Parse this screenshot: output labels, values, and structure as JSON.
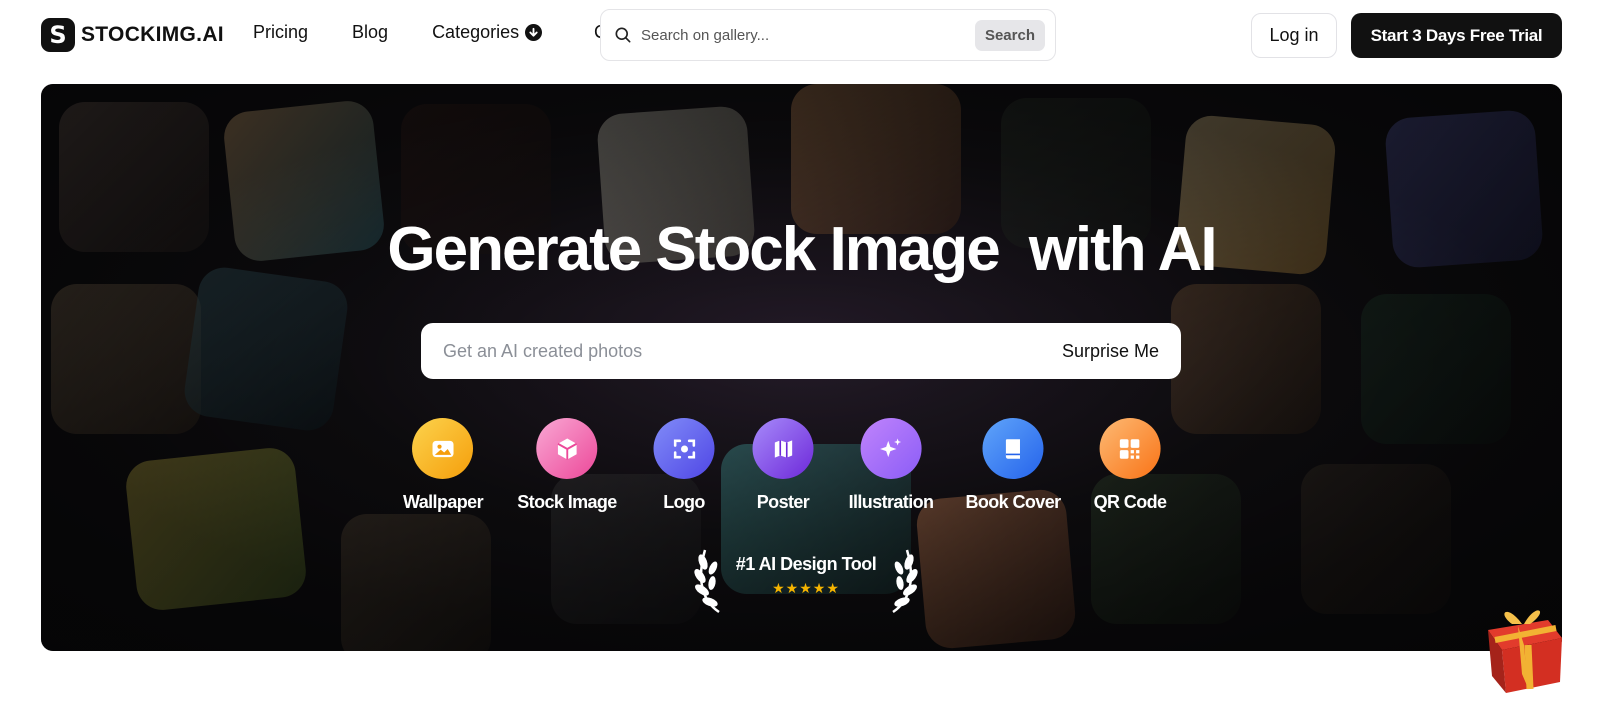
{
  "brand": {
    "name": "STOCKIMG.AI",
    "mark": "S"
  },
  "nav": {
    "items": [
      "Pricing",
      "Blog",
      "Categories"
    ],
    "hidden_item_fragment": "C"
  },
  "gallery_search": {
    "placeholder": "Search on gallery...",
    "button": "Search"
  },
  "auth": {
    "login": "Log in",
    "trial": "Start 3 Days Free Trial"
  },
  "hero": {
    "title_part1": "Generate Stock Image",
    "title_part2": "with AI",
    "prompt_placeholder": "Get an AI created photos",
    "surprise_label": "Surprise Me"
  },
  "categories": [
    {
      "label": "Wallpaper",
      "icon": "image-icon",
      "color_from": "#fcd34d",
      "color_to": "#f59e0b"
    },
    {
      "label": "Stock Image",
      "icon": "cube-icon",
      "color_from": "#f9a8d4",
      "color_to": "#ec4899"
    },
    {
      "label": "Logo",
      "icon": "focus-icon",
      "color_from": "#818cf8",
      "color_to": "#4f46e5"
    },
    {
      "label": "Poster",
      "icon": "map-icon",
      "color_from": "#a78bfa",
      "color_to": "#6d28d9"
    },
    {
      "label": "Illustration",
      "icon": "sparkles-icon",
      "color_from": "#c084fc",
      "color_to": "#8b5cf6"
    },
    {
      "label": "Book Cover",
      "icon": "book-icon",
      "color_from": "#60a5fa",
      "color_to": "#2563eb"
    },
    {
      "label": "QR Code",
      "icon": "qr-icon",
      "color_from": "#fdba74",
      "color_to": "#f97316"
    }
  ],
  "award": {
    "title": "#1 AI Design Tool",
    "stars": "★★★★★"
  },
  "colors": {
    "accent_dark": "#111111",
    "hero_bg": "#0b0b0d"
  }
}
